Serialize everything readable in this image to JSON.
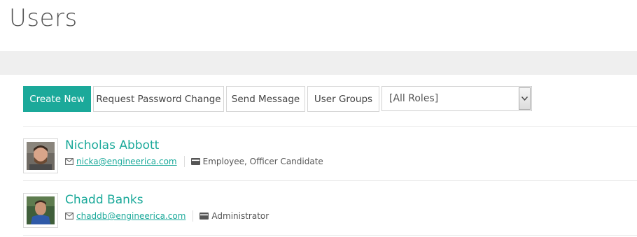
{
  "page": {
    "title": "Users"
  },
  "toolbar": {
    "create_label": "Create New",
    "password_label": "Request Password Change",
    "message_label": "Send Message",
    "groups_label": "User Groups",
    "roles_select_value": "[All Roles]"
  },
  "users": [
    {
      "name": "Nicholas Abbott",
      "email": "nicka@engineerica.com",
      "roles": "Employee, Officer Candidate"
    },
    {
      "name": "Chadd Banks",
      "email": "chaddb@engineerica.com",
      "roles": "Administrator"
    }
  ],
  "icons": {
    "email": "envelope-icon",
    "roles": "id-card-icon",
    "select": "chevron-down-icon"
  },
  "colors": {
    "accent": "#1ba99a",
    "band": "#efefef",
    "text": "#444444"
  }
}
